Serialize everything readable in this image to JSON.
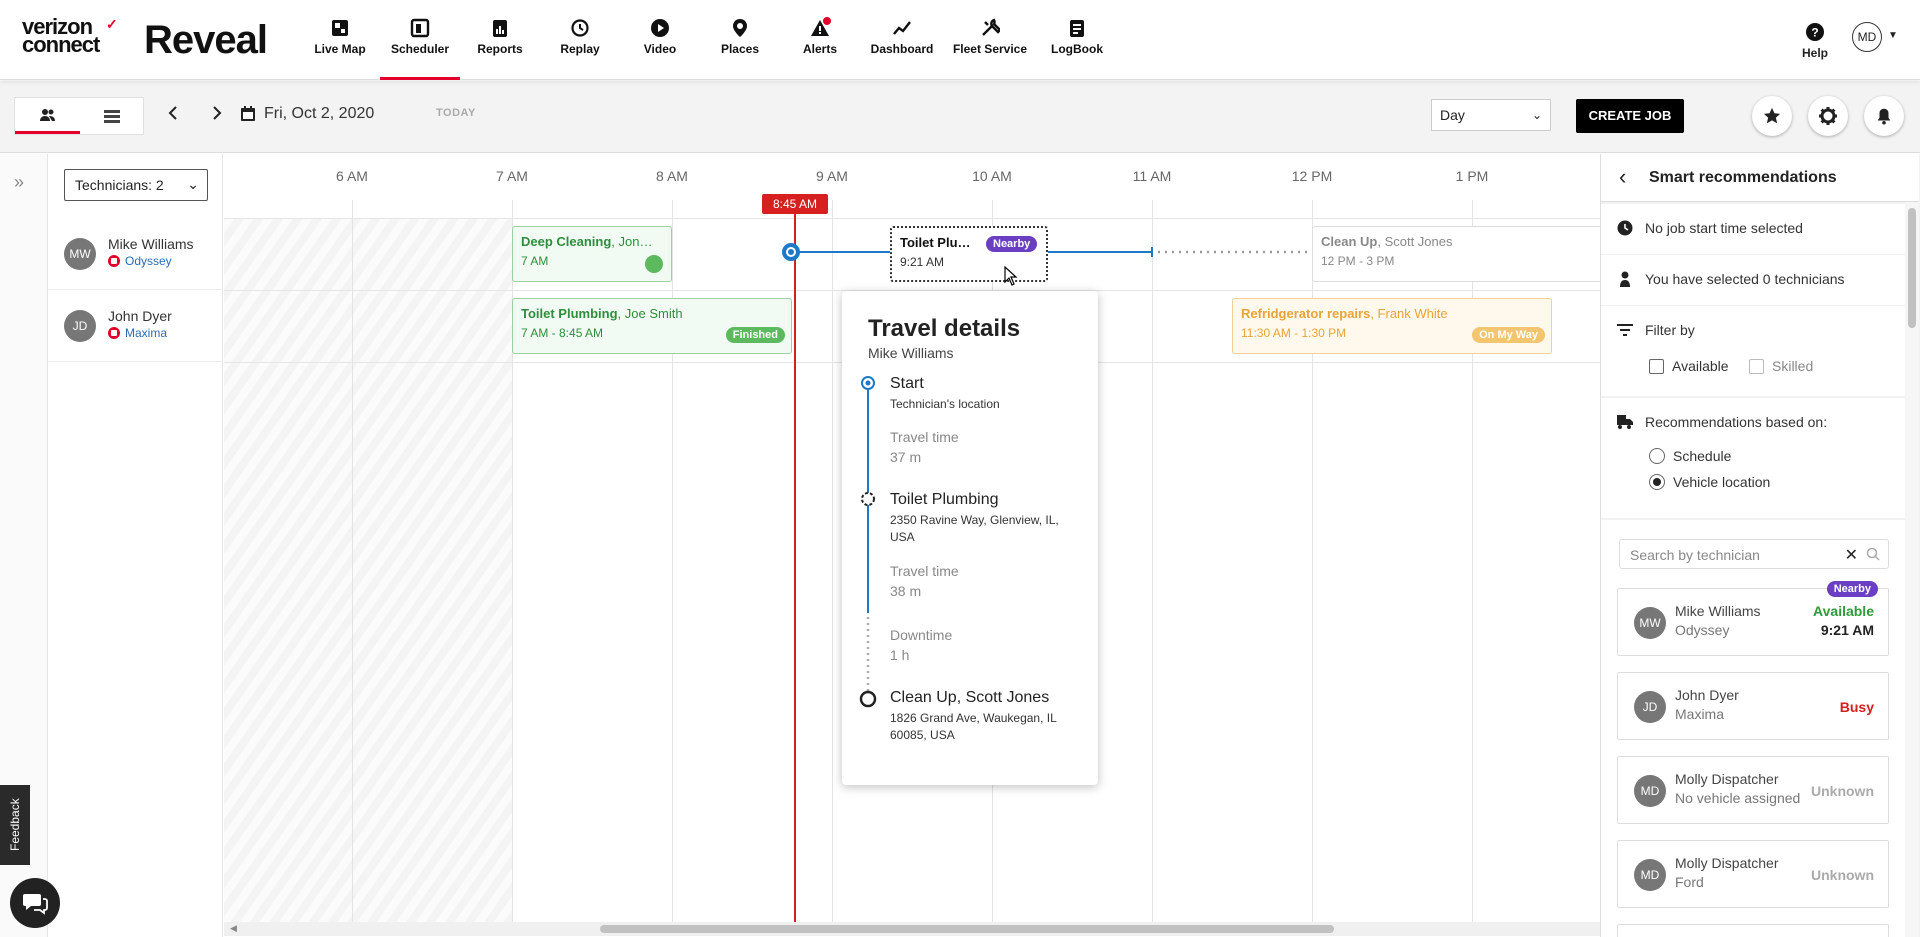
{
  "brand": {
    "line1": "verizon",
    "line2": "connect",
    "check": "✓",
    "product": "Reveal"
  },
  "nav": {
    "items": [
      {
        "label": "Live Map",
        "icon": "map-icon"
      },
      {
        "label": "Scheduler",
        "icon": "scheduler-icon",
        "active": true
      },
      {
        "label": "Reports",
        "icon": "reports-icon"
      },
      {
        "label": "Replay",
        "icon": "replay-icon"
      },
      {
        "label": "Video",
        "icon": "video-icon"
      },
      {
        "label": "Places",
        "icon": "places-icon"
      },
      {
        "label": "Alerts",
        "icon": "alerts-icon"
      },
      {
        "label": "Dashboard",
        "icon": "dashboard-icon"
      },
      {
        "label": "Fleet Service",
        "icon": "fleet-service-icon"
      },
      {
        "label": "LogBook",
        "icon": "logbook-icon"
      }
    ],
    "help": "Help",
    "user_initials": "MD"
  },
  "toolbar": {
    "date": "Fri, Oct 2, 2020",
    "today": "TODAY",
    "view": "Day",
    "create_job": "CREATE JOB"
  },
  "schedule": {
    "tech_filter": "Technicians: 2",
    "hours": [
      "6 AM",
      "7 AM",
      "8 AM",
      "9 AM",
      "10 AM",
      "11 AM",
      "12 PM",
      "1 PM"
    ],
    "now_label": "8:45 AM",
    "technicians": [
      {
        "initials": "MW",
        "name": "Mike Williams",
        "vehicle": "Odyssey"
      },
      {
        "initials": "JD",
        "name": "John Dyer",
        "vehicle": "Maxima"
      }
    ],
    "jobs": {
      "deep_cleaning": {
        "title": "Deep Cleaning",
        "who": ", Jon…",
        "time": "7 AM"
      },
      "toilet_selected": {
        "title": "Toilet Plu…",
        "badge": "Nearby",
        "time": "9:21 AM"
      },
      "clean_up": {
        "title": "Clean Up",
        "who": ", Scott Jones",
        "time": "12 PM - 3 PM"
      },
      "toilet_finished": {
        "title": "Toilet Plumbing",
        "who": ", Joe Smith",
        "time": "7 AM - 8:45 AM",
        "badge": "Finished"
      },
      "refridgerator": {
        "title": "Refridgerator repairs",
        "who": ", Frank White",
        "time": "11:30 AM - 1:30 PM",
        "badge": "On My Way"
      }
    }
  },
  "travel": {
    "title": "Travel details",
    "tech": "Mike Williams",
    "start_title": "Start",
    "start_sub": "Technician's location",
    "travel1_label": "Travel time",
    "travel1_value": "37 m",
    "job_title": "Toilet Plumbing",
    "job_addr1": "2350 Ravine Way, Glenview, IL,",
    "job_addr2": "USA",
    "travel2_label": "Travel time",
    "travel2_value": "38 m",
    "down_label": "Downtime",
    "down_value": "1 h",
    "end_title": "Clean Up, Scott Jones",
    "end_addr1": "1826 Grand Ave, Waukegan, IL",
    "end_addr2": "60085, USA"
  },
  "smart": {
    "title": "Smart recommendations",
    "no_time": "No job start time selected",
    "selected": "You have selected 0 technicians",
    "filter_by": "Filter by",
    "available": "Available",
    "skilled": "Skilled",
    "based_on": "Recommendations based on:",
    "opt_schedule": "Schedule",
    "opt_vehicle": "Vehicle location",
    "search_placeholder": "Search by technician",
    "cards": [
      {
        "initials": "MW",
        "name": "Mike Williams",
        "vehicle": "Odyssey",
        "status": "Available",
        "time": "9:21 AM",
        "badge": "Nearby"
      },
      {
        "initials": "JD",
        "name": "John Dyer",
        "vehicle": "Maxima",
        "status": "Busy"
      },
      {
        "initials": "MD",
        "name": "Molly Dispatcher",
        "vehicle": "No vehicle assigned",
        "status": "Unknown"
      },
      {
        "initials": "MD",
        "name": "Molly Dispatcher",
        "vehicle": "Ford",
        "status": "Unknown"
      }
    ]
  },
  "feedback": "Feedback",
  "colors": {
    "accent_red": "#e4002b",
    "nearby_purple": "#6b3fc4",
    "available_green": "#2e9a3a",
    "busy_red": "#d62020",
    "timeline_blue": "#1e78c8"
  }
}
